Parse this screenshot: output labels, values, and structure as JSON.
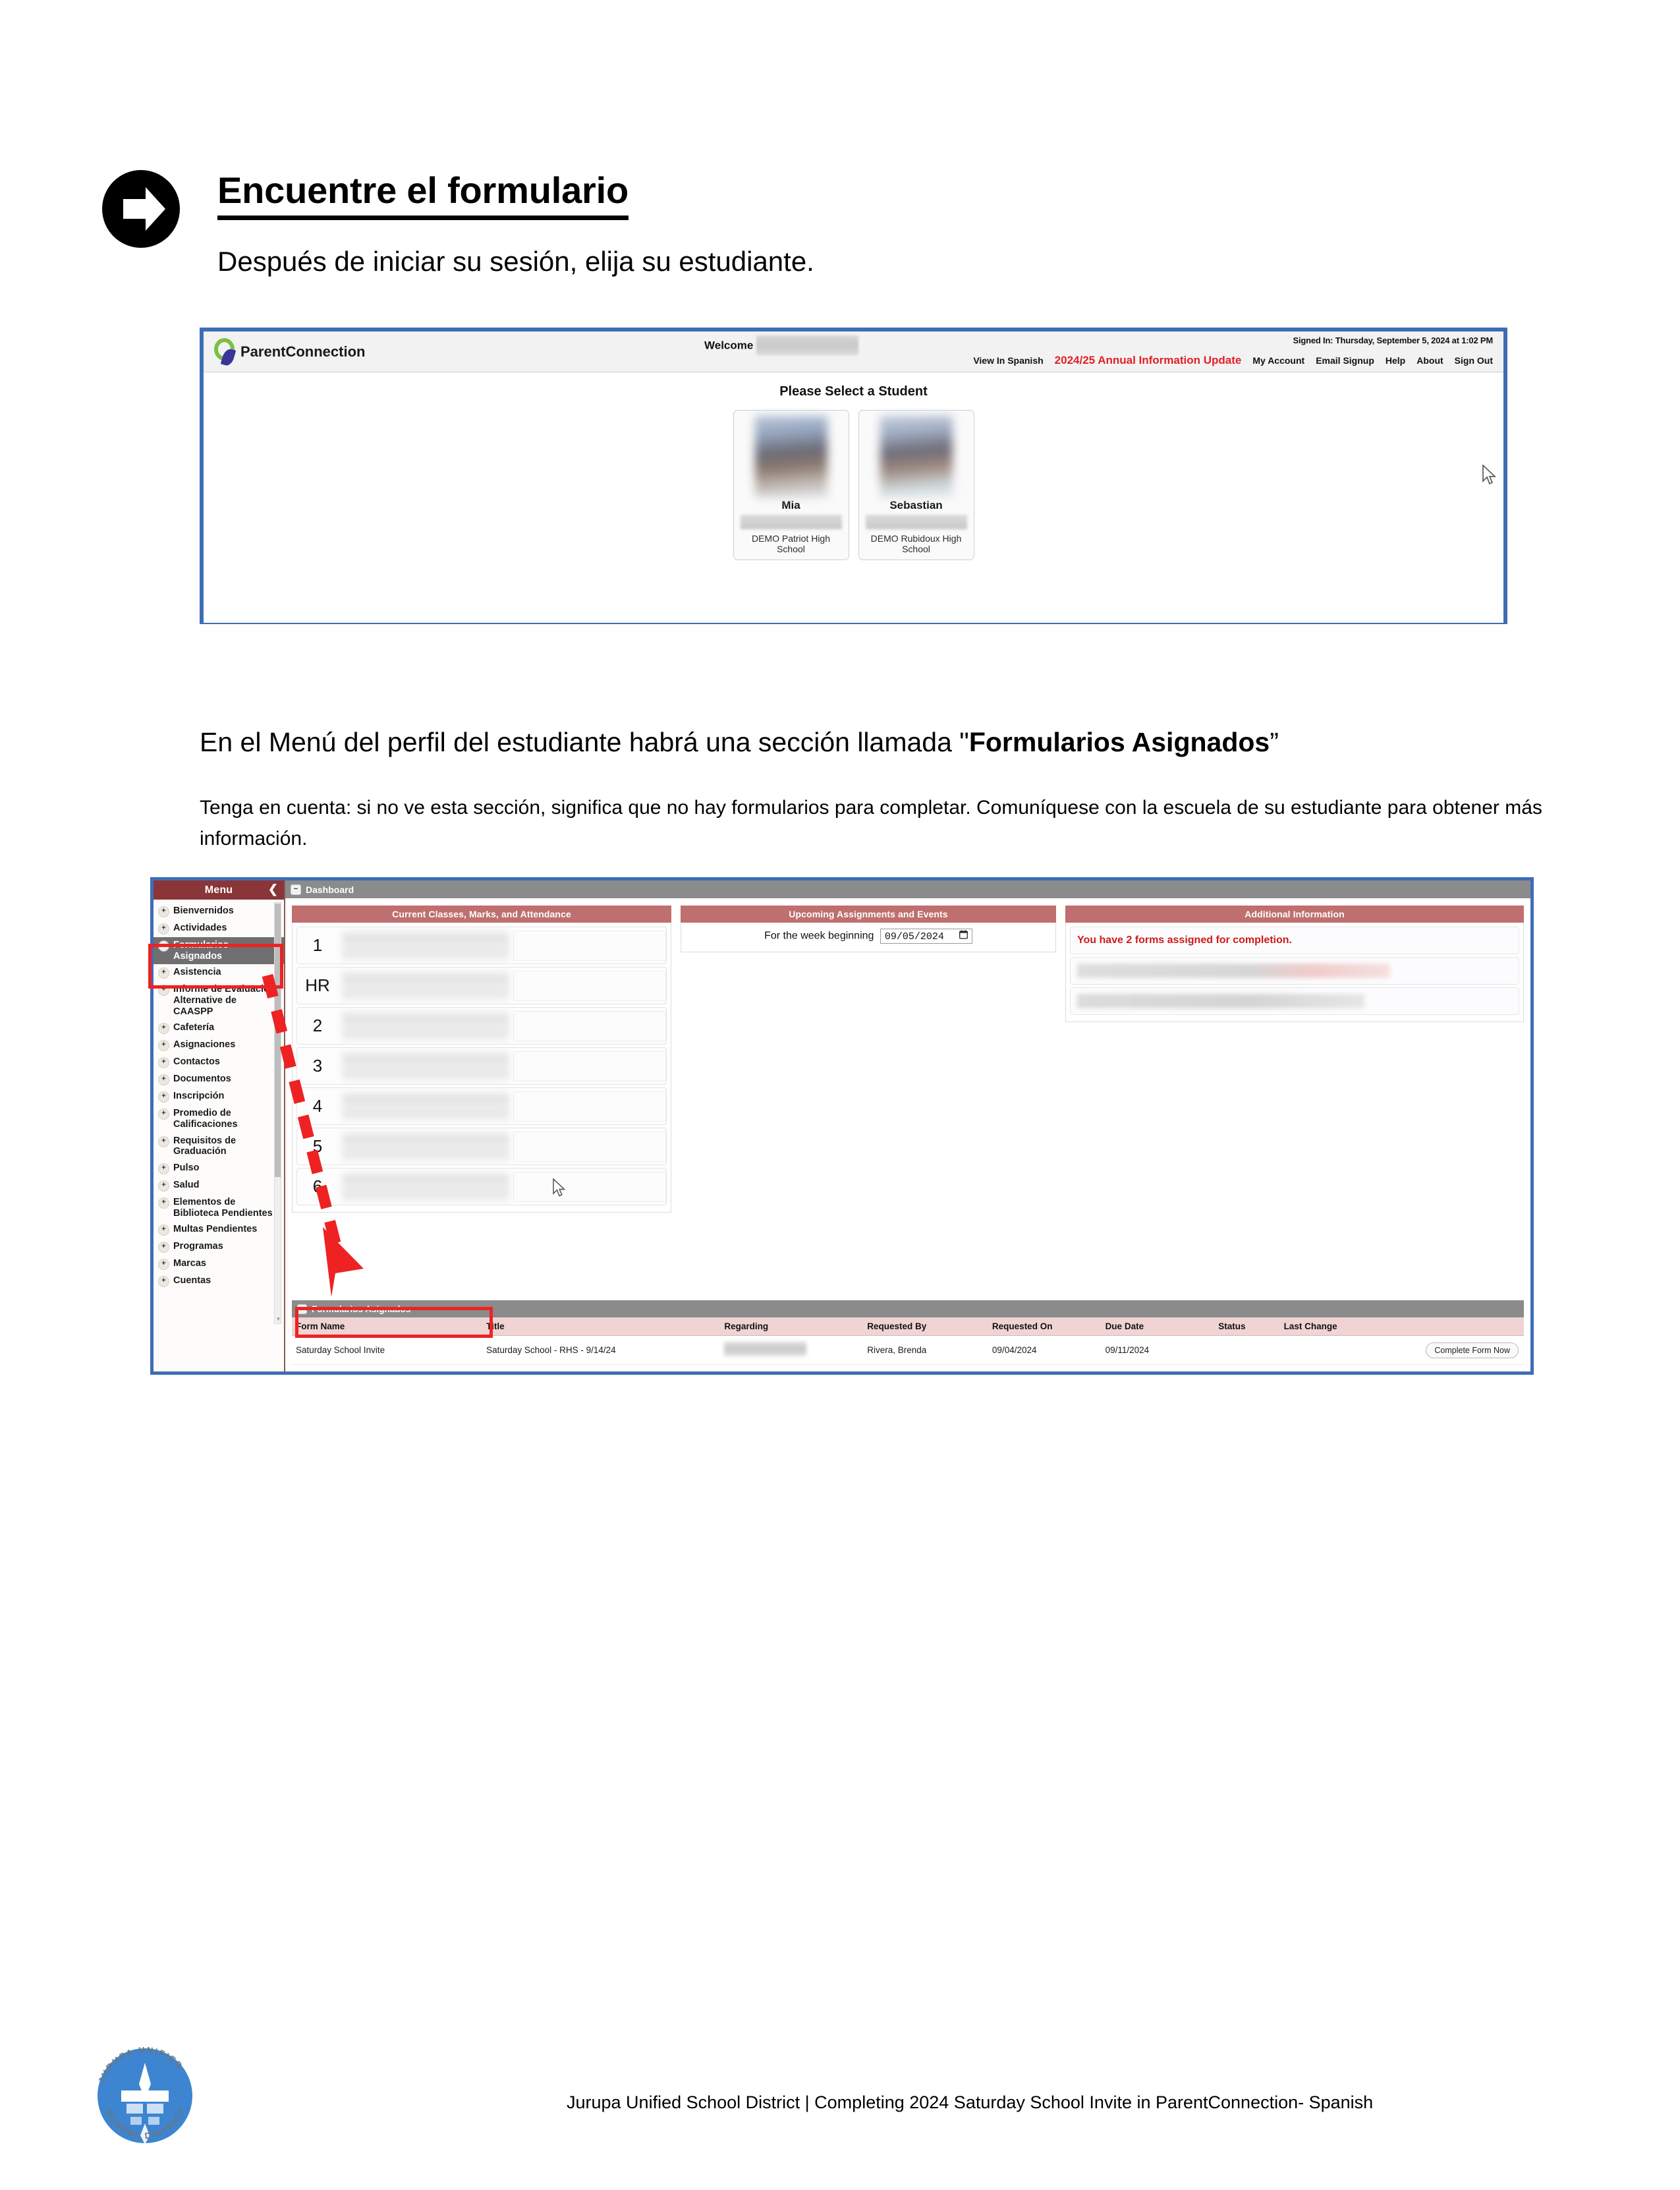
{
  "heading": {
    "title": "Encuentre el formulario",
    "subtitle": "Después de iniciar su sesión, elija su estudiante."
  },
  "mid": {
    "lead_prefix": "En el Menú del perfil del estudiante habrá una sección llamada \"",
    "lead_bold": "Formularios Asignados",
    "lead_suffix": "”",
    "note": "Tenga en cuenta: si no ve esta sección, significa que no hay formularios para completar. Comuníquese con la escuela de su estudiante para obtener más información."
  },
  "shot1": {
    "brand": "ParentConnection",
    "welcome_label": "Welcome",
    "signed_in": "Signed In: Thursday, September 5, 2024 at 1:02 PM",
    "nav": [
      {
        "label": "View In Spanish",
        "accent": false
      },
      {
        "label": "2024/25 Annual Information Update",
        "accent": true
      },
      {
        "label": "My Account",
        "accent": false
      },
      {
        "label": "Email Signup",
        "accent": false
      },
      {
        "label": "Help",
        "accent": false
      },
      {
        "label": "About",
        "accent": false
      },
      {
        "label": "Sign Out",
        "accent": false
      }
    ],
    "select_title": "Please Select a Student",
    "students": [
      {
        "name": "Mia",
        "school": "DEMO Patriot High School"
      },
      {
        "name": "Sebastian",
        "school": "DEMO Rubidoux High School"
      }
    ]
  },
  "shot2": {
    "sidebar": {
      "title": "Menu",
      "collapse_icon": "❮",
      "items": [
        {
          "label": "Bienvernidos",
          "toggle": "+",
          "active": false
        },
        {
          "label": "Actividades",
          "toggle": "+",
          "active": false
        },
        {
          "label": "Formularios Asignados",
          "toggle": "−",
          "active": true
        },
        {
          "label": "Asistencia",
          "toggle": "+",
          "active": false
        },
        {
          "label": "Informe de Evaluación Alternative de CAASPP",
          "toggle": "+",
          "active": false
        },
        {
          "label": "Cafetería",
          "toggle": "+",
          "active": false
        },
        {
          "label": "Asignaciones",
          "toggle": "+",
          "active": false
        },
        {
          "label": "Contactos",
          "toggle": "+",
          "active": false
        },
        {
          "label": "Documentos",
          "toggle": "+",
          "active": false
        },
        {
          "label": "Inscripción",
          "toggle": "+",
          "active": false
        },
        {
          "label": "Promedio de Calificaciones",
          "toggle": "+",
          "active": false
        },
        {
          "label": "Requisitos de Graduación",
          "toggle": "+",
          "active": false
        },
        {
          "label": "Pulso",
          "toggle": "+",
          "active": false
        },
        {
          "label": "Salud",
          "toggle": "+",
          "active": false
        },
        {
          "label": "Elementos de Biblioteca Pendientes",
          "toggle": "+",
          "active": false
        },
        {
          "label": "Multas Pendientes",
          "toggle": "+",
          "active": false
        },
        {
          "label": "Programas",
          "toggle": "+",
          "active": false
        },
        {
          "label": "Marcas",
          "toggle": "+",
          "active": false
        },
        {
          "label": "Cuentas",
          "toggle": "+",
          "active": false
        }
      ]
    },
    "dashboard_label": "Dashboard",
    "panels": {
      "classes_title": "Current Classes, Marks, and Attendance",
      "periods": [
        "1",
        "HR",
        "2",
        "3",
        "4",
        "5",
        "6"
      ],
      "upcoming_title": "Upcoming Assignments and Events",
      "week_label": "For the week beginning",
      "week_value": "09/05/2024",
      "calendar_icon": "Ὄ5",
      "additional_title": "Additional Information",
      "alert": "You have 2 forms assigned for completion."
    },
    "forms": {
      "section_title": "Formularios Asignados",
      "columns": [
        "Form Name",
        "Title",
        "Regarding",
        "Requested By",
        "Requested On",
        "Due Date",
        "Status",
        "Last Change",
        ""
      ],
      "rows": [
        {
          "form_name": "Saturday School Invite",
          "title": "Saturday School - RHS - 9/14/24",
          "regarding": "",
          "requested_by": "Rivera, Brenda",
          "requested_on": "09/04/2024",
          "due_date": "09/11/2024",
          "status": "",
          "last_change": "",
          "action": "Complete Form Now"
        }
      ]
    }
  },
  "footer": {
    "text": "Jurupa Unified School District | Completing 2024 Saturday School Invite in ParentConnection- Spanish",
    "logo_top": "JURUPA UNIFIED",
    "logo_bottom": "SCHOOL DISTRICT"
  },
  "colors": {
    "accent_red": "#e21f26",
    "panel_header": "#bf6f6f",
    "menu_header": "#8a3538",
    "highlight": "#ee2222",
    "screenshot_border": "#3f6db5",
    "brand_green": "#7ac143",
    "brand_purple": "#3b3598"
  }
}
